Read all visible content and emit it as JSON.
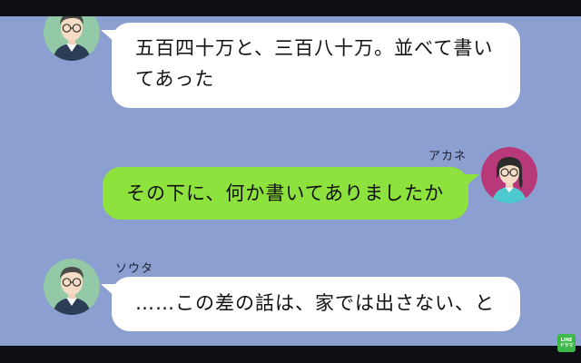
{
  "messages": [
    {
      "sender": "",
      "side": "left",
      "lines": [
        "五百四十万と、三百八十万。並べて書い",
        "てあった"
      ]
    },
    {
      "sender": "アカネ",
      "side": "right",
      "lines": [
        "その下に、何か書いてありましたか"
      ]
    },
    {
      "sender": "ソウタ",
      "side": "left",
      "lines": [
        "……この差の話は、家では出さない、と"
      ]
    }
  ],
  "logo": {
    "line1": "LINE",
    "line2": "ドラマ",
    "color": "#3fb84a"
  },
  "colors": {
    "background": "#8b9fd0",
    "bubble_white": "#ffffff",
    "bubble_green": "#8ee23e"
  }
}
